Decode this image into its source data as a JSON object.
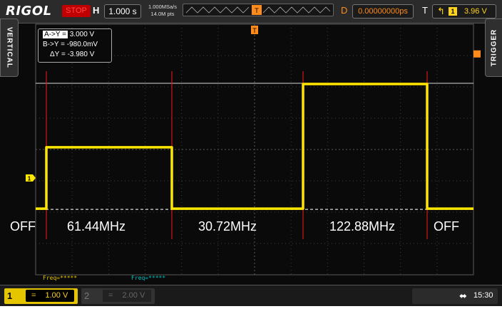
{
  "header": {
    "brand": "RIGOL",
    "run_status": "STOP",
    "horizontal_label": "H",
    "timebase": "1.000 s",
    "sample_rate": "1.000MSa/s",
    "memory_depth": "14.0M pts",
    "delay_label": "D",
    "delay_value": "0.00000000ps",
    "trigger_label": "T",
    "trigger_source": "1",
    "trigger_level": "3.96 V"
  },
  "side_tabs": {
    "left": "VERTICAL",
    "right": "TRIGGER"
  },
  "cursor_readout": {
    "ay_label": "A->Y =",
    "ay_value": "3.000 V",
    "by_label": "B->Y =",
    "by_value": "-980.0mV",
    "dy_label": "ΔY =",
    "dy_value": "-3.980 V"
  },
  "region_labels": [
    "OFF",
    "61.44MHz",
    "30.72MHz",
    "122.88MHz",
    "OFF"
  ],
  "markers": {
    "trigger_marker": "T",
    "channel_marker": "1"
  },
  "waveform": {
    "channel": "CH1",
    "color": "#ffe600",
    "levels_v": [
      -0.98,
      0.98,
      -0.98,
      3.0,
      -0.98
    ],
    "cursor_a_v": 3.0,
    "cursor_b_v": -0.98
  },
  "footer": {
    "freq1": "Freq=*****",
    "freq2": "Freq=*****",
    "ch1_number": "1",
    "ch1_coupling": "=",
    "ch1_scale": "1.00 V",
    "ch2_number": "2",
    "ch2_coupling": "=",
    "ch2_scale": "2.00 V",
    "usb_icon": "usb-icon",
    "time": "15:30"
  },
  "colors": {
    "ch1": "#ffe600",
    "ch2": "#00c0c0",
    "trigger": "#ff8c1a",
    "cursor_lines": "#d01818"
  }
}
